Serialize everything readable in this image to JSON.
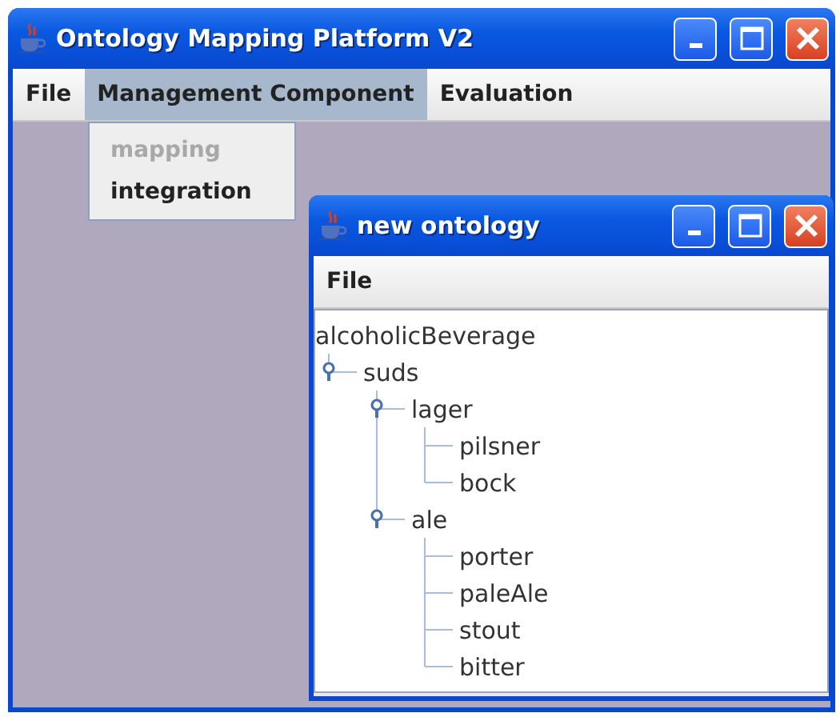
{
  "window": {
    "title": "Ontology Mapping Platform V2"
  },
  "menu_bar": [
    {
      "label": "File",
      "selected": false
    },
    {
      "label": "Management Component",
      "selected": true
    },
    {
      "label": "Evaluation",
      "selected": false
    }
  ],
  "open_menu": {
    "items": [
      {
        "label": "mapping",
        "disabled": true
      },
      {
        "label": "integration",
        "disabled": false
      }
    ]
  },
  "inner_window": {
    "title": "new ontology",
    "menu_bar": [
      {
        "label": "File",
        "selected": false
      }
    ],
    "tree": {
      "label": "alcoholicBeverage",
      "children": [
        {
          "label": "suds",
          "expanded": true,
          "children": [
            {
              "label": "lager",
              "expanded": true,
              "children": [
                {
                  "label": "pilsner"
                },
                {
                  "label": "bock"
                }
              ]
            },
            {
              "label": "ale",
              "expanded": true,
              "children": [
                {
                  "label": "porter"
                },
                {
                  "label": "paleAle"
                },
                {
                  "label": "stout"
                },
                {
                  "label": "bitter"
                }
              ]
            }
          ]
        }
      ]
    }
  }
}
